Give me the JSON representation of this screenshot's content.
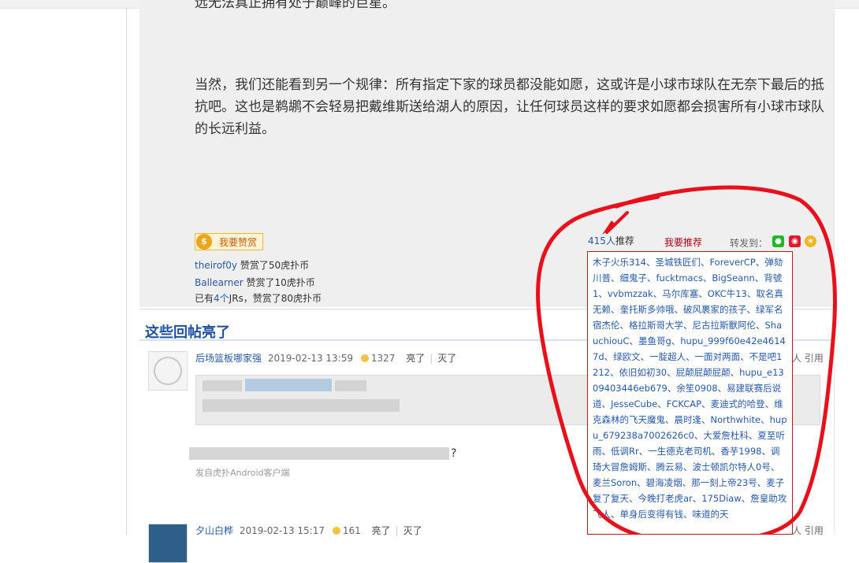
{
  "article": {
    "clipped_line": "远无法真正拥有处于巅峰的巨星。",
    "paragraph": "当然，我们还能看到另一个规律：所有指定下家的球员都没能如愿，这或许是小球市球队在无奈下最后的抵抗吧。这也是鹈鹕不会轻易把戴维斯送给湖人的原因，让任何球员这样的要求如愿都会损害所有小球市球队的长远利益。"
  },
  "reward": {
    "button_label": "我要赞赏",
    "coin_glyph": "$",
    "lines": [
      {
        "user": "theirof0y",
        "text": " 赞赏了50虎扑币"
      },
      {
        "user": "Ballearner",
        "text": " 赞赏了10虎扑币"
      }
    ],
    "summary_prefix": "已有",
    "summary_count": "4个",
    "summary_suffix": "JRs，赞赏了80虎扑币"
  },
  "recommend": {
    "count": "415人",
    "count_suffix": "推荐",
    "button": "我要推荐",
    "share_label": "转发到：",
    "share_icons": [
      "wechat-icon",
      "weibo-icon",
      "qzone-icon"
    ],
    "recommenders_text": "木子火乐314、圣城铁匠们、ForeverCP、弹劾川普、细鬼子、fucktmacs、BigSeann、背號1、vvbmzzak、马尔库塞、OKC牛13、取名真无赖、奎托斯多帅哦、破风裹家的孩子、绿军名宿杰伦、格拉斯哥大学、尼古拉斯獸阿伦、ShauchiouC、墨鱼哥g、hupu_999f60e42e46147d、绿欧文、一腚超人、一面对两面、不是吧1212、依旧如初30、屁颠屁颠屁颠、hupu_e1309403446eb679、余笙0908、易建联赛后说道、JesseCube、FCKCAP、麦迪式的哈登、维克森林的飞天魔鬼、晨时逢、Northwhite、hupu_679238a7002626c0、大爱詹杜科、夏至听雨、低调Rr、一生德克老司机、香芋1998、调琦大冒詹姆斯、腾云易、波士顿凯尔特人0号、麦兰Soron、碧海凌烟、那一刻上帝23号、麦子复了复天、今晚打老虎ar、175Diaw、詹皇助攻飞人、单身后变得有钱、味道的天"
  },
  "hot_replies": {
    "title": "这些回帖亮了",
    "replies": [
      {
        "user": "后场篮板哪家强",
        "time": "2019-02-13 13:59",
        "lights": "1327",
        "light_label": "亮了",
        "dark_label": "灭了",
        "tail": "?",
        "client": "发自虎扑Android客户端",
        "right_partial": "人  引用"
      },
      {
        "user": "夕山白桦",
        "time": "2019-02-13 15:17",
        "lights": "161",
        "light_label": "亮了",
        "dark_label": "灭了",
        "right_partial": "人  引用"
      }
    ]
  },
  "colors": {
    "link": "#2659a8",
    "title": "#1f4fa0",
    "annotation": "#e8101a",
    "recommend": "#a8001c"
  }
}
